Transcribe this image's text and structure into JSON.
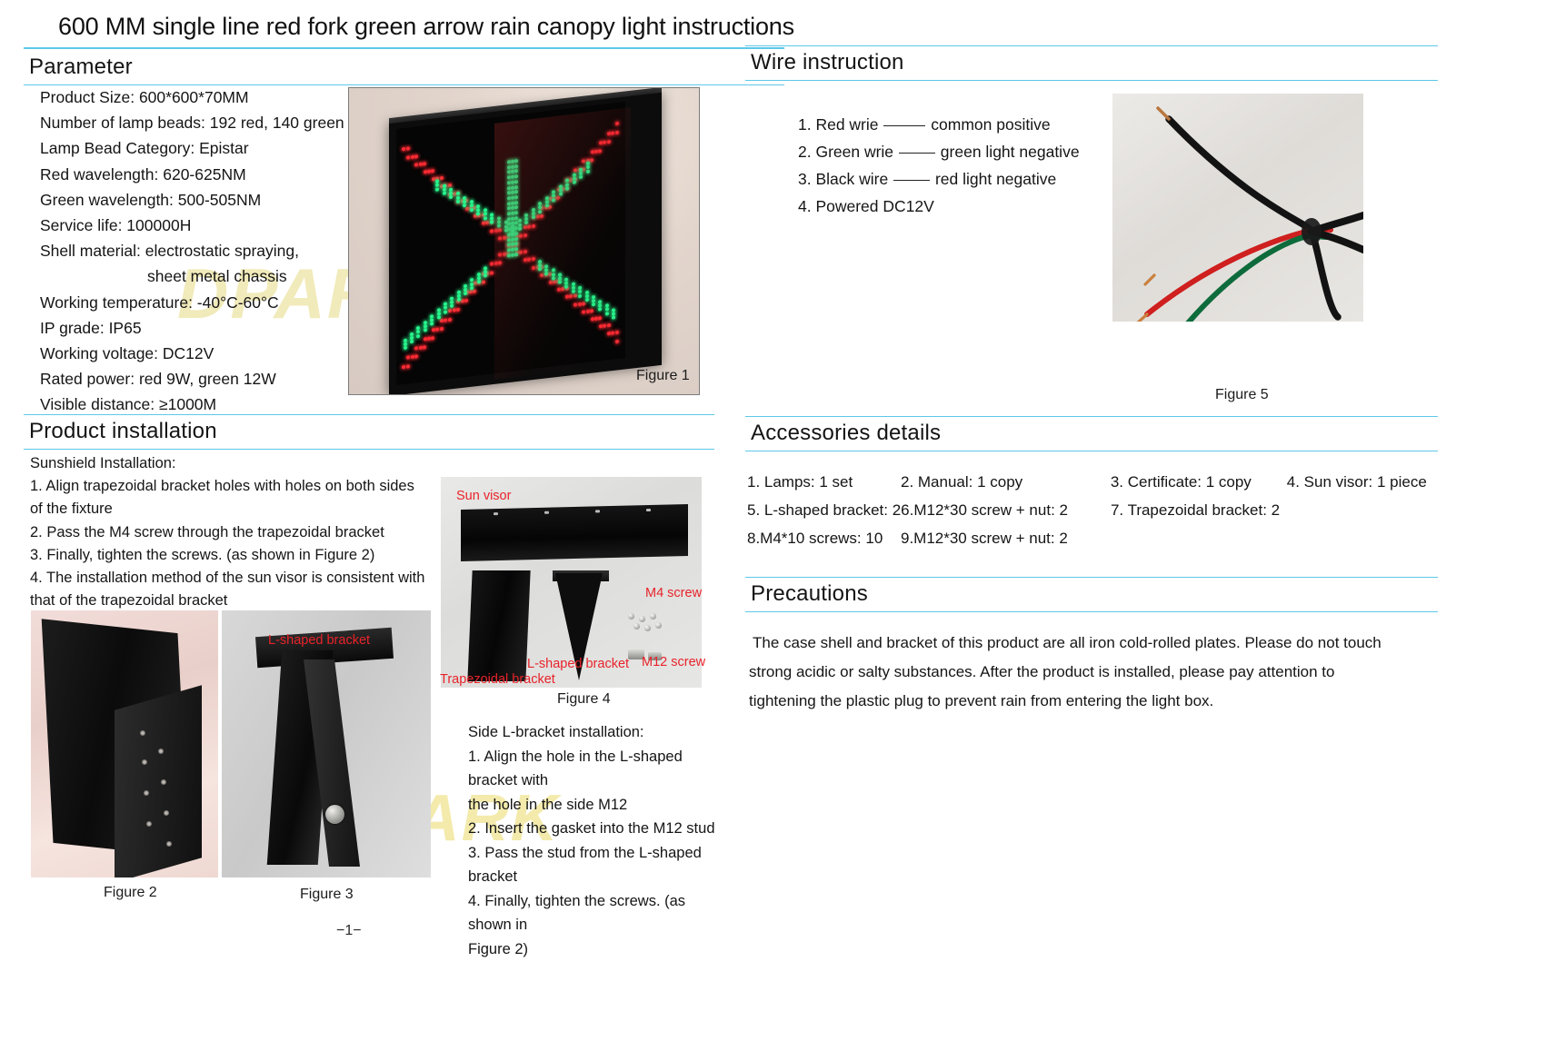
{
  "document": {
    "title": "600 MM single line red fork green arrow rain canopy light instructions",
    "page_number": "−1−",
    "watermark": "DPARK",
    "accent_color": "#5ec8e8",
    "label_color": "#e8232a"
  },
  "sections": {
    "parameter": {
      "heading": "Parameter",
      "rows": [
        "Product Size: 600*600*70MM",
        "Number of lamp beads: 192 red, 140 green",
        "Lamp Bead Category: Epistar",
        "Red wavelength: 620-625NM",
        "Green wavelength: 500-505NM",
        "Service life: 100000H",
        "Shell material: electrostatic spraying,",
        "sheet metal chassis",
        "Working temperature: -40°C-60°C",
        "IP grade: IP65",
        "Working voltage: DC12V",
        "Rated power: red 9W, green 12W",
        "Visible distance: ≥1000M"
      ]
    },
    "product_installation": {
      "heading": "Product installation",
      "sunshield": {
        "subheading": "Sunshield Installation:",
        "lines": [
          "1. Align trapezoidal bracket holes with holes on both sides",
          "of the fixture",
          "2. Pass the M4 screw through the trapezoidal bracket",
          "3. Finally, tighten the screws. (as shown in Figure 2)",
          "4. The installation method of the sun visor is consistent with",
          "that of the trapezoidal bracket"
        ]
      },
      "side_lbracket": {
        "subheading": "Side L-bracket installation:",
        "lines": [
          "1. Align the hole in the L-shaped bracket with",
          "the hole in the side M12",
          "2. Insert the gasket into the M12 stud",
          "3. Pass the stud from the L-shaped bracket",
          "4. Finally, tighten the screws. (as shown in",
          "Figure 2)"
        ]
      }
    },
    "wire_instruction": {
      "heading": "Wire  instruction",
      "items": [
        {
          "index": "1. Red wrie",
          "value": "common  positive"
        },
        {
          "index": "2. Green wrie",
          "value": "green  light  negative"
        },
        {
          "index": "3. Black wire",
          "value": "red  light  negative"
        },
        {
          "index": "4. Powered DC12V",
          "value": ""
        }
      ]
    },
    "accessories_details": {
      "heading": "Accessories details",
      "rows": [
        [
          "1. Lamps: 1 set",
          "2. Manual: 1 copy",
          "3. Certificate: 1 copy",
          "4. Sun visor: 1 piece"
        ],
        [
          "5. L-shaped bracket: 2",
          "6.M12*30 screw + nut: 2",
          "7. Trapezoidal bracket: 2",
          ""
        ],
        [
          "8.M4*10 screws: 10",
          "9.M12*30 screw + nut: 2",
          "",
          ""
        ]
      ]
    },
    "precautions": {
      "heading": "Precautions",
      "lines": [
        "The case shell and bracket of this product are all iron cold-rolled plates. Please do not touch",
        "strong acidic or salty substances. After the product is installed, please pay attention to",
        "tightening the plastic plug to prevent rain from entering the light box."
      ]
    }
  },
  "figures": {
    "figure1": {
      "caption": "Figure 1"
    },
    "figure2": {
      "caption": "Figure 2"
    },
    "figure3": {
      "caption": "Figure 3",
      "label_lbracket": "L-shaped bracket"
    },
    "figure4": {
      "caption": "Figure 4",
      "label_sun_visor": "Sun visor",
      "label_m4_screw": "M4 screw",
      "label_m12_screw": "M12 screw",
      "label_lbracket": "L-shaped bracket",
      "label_trapezoidal": "Trapezoidal bracket"
    },
    "figure5": {
      "caption": "Figure 5"
    }
  }
}
